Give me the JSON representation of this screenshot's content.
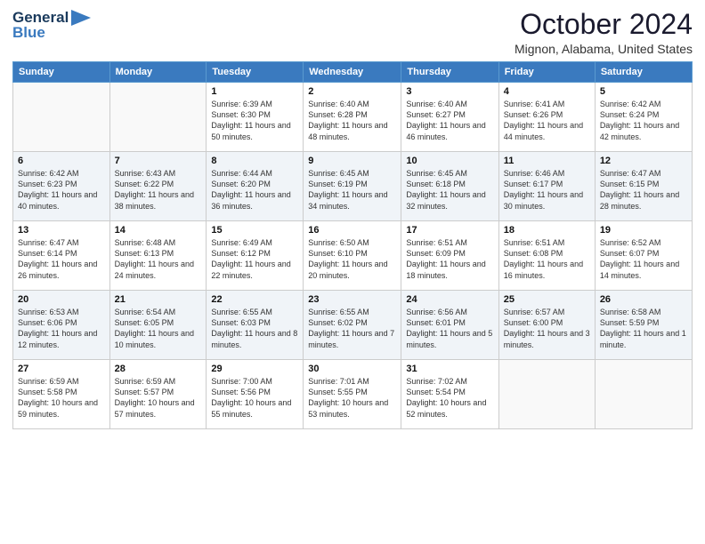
{
  "header": {
    "logo_line1": "General",
    "logo_line2": "Blue",
    "month": "October 2024",
    "location": "Mignon, Alabama, United States"
  },
  "weekdays": [
    "Sunday",
    "Monday",
    "Tuesday",
    "Wednesday",
    "Thursday",
    "Friday",
    "Saturday"
  ],
  "weeks": [
    [
      {
        "day": "",
        "sunrise": "",
        "sunset": "",
        "daylight": ""
      },
      {
        "day": "",
        "sunrise": "",
        "sunset": "",
        "daylight": ""
      },
      {
        "day": "1",
        "sunrise": "Sunrise: 6:39 AM",
        "sunset": "Sunset: 6:30 PM",
        "daylight": "Daylight: 11 hours and 50 minutes."
      },
      {
        "day": "2",
        "sunrise": "Sunrise: 6:40 AM",
        "sunset": "Sunset: 6:28 PM",
        "daylight": "Daylight: 11 hours and 48 minutes."
      },
      {
        "day": "3",
        "sunrise": "Sunrise: 6:40 AM",
        "sunset": "Sunset: 6:27 PM",
        "daylight": "Daylight: 11 hours and 46 minutes."
      },
      {
        "day": "4",
        "sunrise": "Sunrise: 6:41 AM",
        "sunset": "Sunset: 6:26 PM",
        "daylight": "Daylight: 11 hours and 44 minutes."
      },
      {
        "day": "5",
        "sunrise": "Sunrise: 6:42 AM",
        "sunset": "Sunset: 6:24 PM",
        "daylight": "Daylight: 11 hours and 42 minutes."
      }
    ],
    [
      {
        "day": "6",
        "sunrise": "Sunrise: 6:42 AM",
        "sunset": "Sunset: 6:23 PM",
        "daylight": "Daylight: 11 hours and 40 minutes."
      },
      {
        "day": "7",
        "sunrise": "Sunrise: 6:43 AM",
        "sunset": "Sunset: 6:22 PM",
        "daylight": "Daylight: 11 hours and 38 minutes."
      },
      {
        "day": "8",
        "sunrise": "Sunrise: 6:44 AM",
        "sunset": "Sunset: 6:20 PM",
        "daylight": "Daylight: 11 hours and 36 minutes."
      },
      {
        "day": "9",
        "sunrise": "Sunrise: 6:45 AM",
        "sunset": "Sunset: 6:19 PM",
        "daylight": "Daylight: 11 hours and 34 minutes."
      },
      {
        "day": "10",
        "sunrise": "Sunrise: 6:45 AM",
        "sunset": "Sunset: 6:18 PM",
        "daylight": "Daylight: 11 hours and 32 minutes."
      },
      {
        "day": "11",
        "sunrise": "Sunrise: 6:46 AM",
        "sunset": "Sunset: 6:17 PM",
        "daylight": "Daylight: 11 hours and 30 minutes."
      },
      {
        "day": "12",
        "sunrise": "Sunrise: 6:47 AM",
        "sunset": "Sunset: 6:15 PM",
        "daylight": "Daylight: 11 hours and 28 minutes."
      }
    ],
    [
      {
        "day": "13",
        "sunrise": "Sunrise: 6:47 AM",
        "sunset": "Sunset: 6:14 PM",
        "daylight": "Daylight: 11 hours and 26 minutes."
      },
      {
        "day": "14",
        "sunrise": "Sunrise: 6:48 AM",
        "sunset": "Sunset: 6:13 PM",
        "daylight": "Daylight: 11 hours and 24 minutes."
      },
      {
        "day": "15",
        "sunrise": "Sunrise: 6:49 AM",
        "sunset": "Sunset: 6:12 PM",
        "daylight": "Daylight: 11 hours and 22 minutes."
      },
      {
        "day": "16",
        "sunrise": "Sunrise: 6:50 AM",
        "sunset": "Sunset: 6:10 PM",
        "daylight": "Daylight: 11 hours and 20 minutes."
      },
      {
        "day": "17",
        "sunrise": "Sunrise: 6:51 AM",
        "sunset": "Sunset: 6:09 PM",
        "daylight": "Daylight: 11 hours and 18 minutes."
      },
      {
        "day": "18",
        "sunrise": "Sunrise: 6:51 AM",
        "sunset": "Sunset: 6:08 PM",
        "daylight": "Daylight: 11 hours and 16 minutes."
      },
      {
        "day": "19",
        "sunrise": "Sunrise: 6:52 AM",
        "sunset": "Sunset: 6:07 PM",
        "daylight": "Daylight: 11 hours and 14 minutes."
      }
    ],
    [
      {
        "day": "20",
        "sunrise": "Sunrise: 6:53 AM",
        "sunset": "Sunset: 6:06 PM",
        "daylight": "Daylight: 11 hours and 12 minutes."
      },
      {
        "day": "21",
        "sunrise": "Sunrise: 6:54 AM",
        "sunset": "Sunset: 6:05 PM",
        "daylight": "Daylight: 11 hours and 10 minutes."
      },
      {
        "day": "22",
        "sunrise": "Sunrise: 6:55 AM",
        "sunset": "Sunset: 6:03 PM",
        "daylight": "Daylight: 11 hours and 8 minutes."
      },
      {
        "day": "23",
        "sunrise": "Sunrise: 6:55 AM",
        "sunset": "Sunset: 6:02 PM",
        "daylight": "Daylight: 11 hours and 7 minutes."
      },
      {
        "day": "24",
        "sunrise": "Sunrise: 6:56 AM",
        "sunset": "Sunset: 6:01 PM",
        "daylight": "Daylight: 11 hours and 5 minutes."
      },
      {
        "day": "25",
        "sunrise": "Sunrise: 6:57 AM",
        "sunset": "Sunset: 6:00 PM",
        "daylight": "Daylight: 11 hours and 3 minutes."
      },
      {
        "day": "26",
        "sunrise": "Sunrise: 6:58 AM",
        "sunset": "Sunset: 5:59 PM",
        "daylight": "Daylight: 11 hours and 1 minute."
      }
    ],
    [
      {
        "day": "27",
        "sunrise": "Sunrise: 6:59 AM",
        "sunset": "Sunset: 5:58 PM",
        "daylight": "Daylight: 10 hours and 59 minutes."
      },
      {
        "day": "28",
        "sunrise": "Sunrise: 6:59 AM",
        "sunset": "Sunset: 5:57 PM",
        "daylight": "Daylight: 10 hours and 57 minutes."
      },
      {
        "day": "29",
        "sunrise": "Sunrise: 7:00 AM",
        "sunset": "Sunset: 5:56 PM",
        "daylight": "Daylight: 10 hours and 55 minutes."
      },
      {
        "day": "30",
        "sunrise": "Sunrise: 7:01 AM",
        "sunset": "Sunset: 5:55 PM",
        "daylight": "Daylight: 10 hours and 53 minutes."
      },
      {
        "day": "31",
        "sunrise": "Sunrise: 7:02 AM",
        "sunset": "Sunset: 5:54 PM",
        "daylight": "Daylight: 10 hours and 52 minutes."
      },
      {
        "day": "",
        "sunrise": "",
        "sunset": "",
        "daylight": ""
      },
      {
        "day": "",
        "sunrise": "",
        "sunset": "",
        "daylight": ""
      }
    ]
  ]
}
